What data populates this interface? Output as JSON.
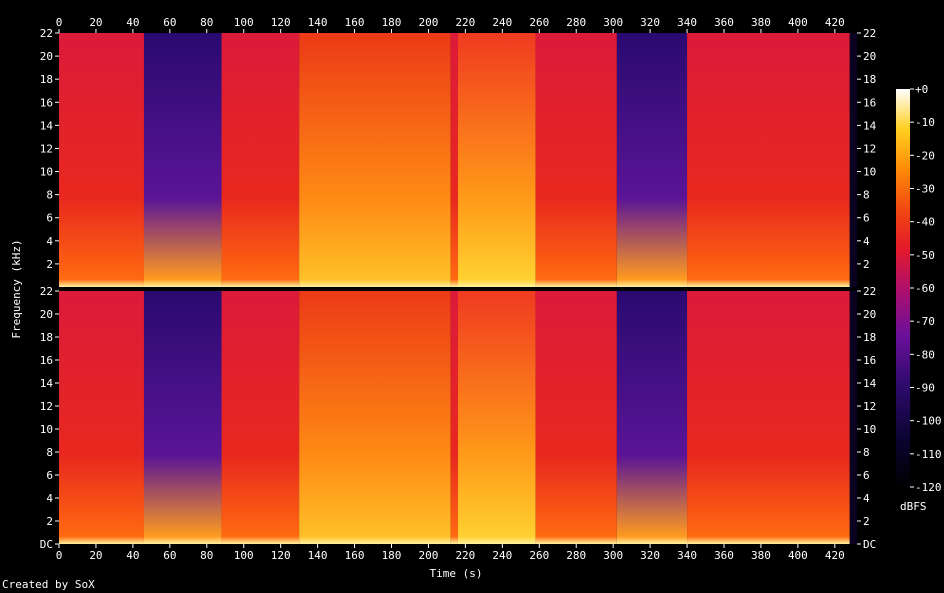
{
  "chart_data": {
    "type": "heatmap",
    "title": "",
    "xlabel": "Time (s)",
    "ylabel": "Frequency (kHz)",
    "colorbar_label": "dBFS",
    "x_ticks": [
      "0",
      "20",
      "40",
      "60",
      "80",
      "100",
      "120",
      "140",
      "160",
      "180",
      "200",
      "220",
      "240",
      "260",
      "280",
      "300",
      "320",
      "340",
      "360",
      "380",
      "400",
      "420"
    ],
    "x_range": [
      0,
      432
    ],
    "y_ticks": [
      "2",
      "4",
      "6",
      "8",
      "10",
      "12",
      "14",
      "16",
      "18",
      "20",
      "22"
    ],
    "y_ticks_lower_bottom": "DC",
    "y_range_khz": [
      0,
      22
    ],
    "colorbar_ticks": [
      "+0",
      "-10",
      "-20",
      "-30",
      "-40",
      "-50",
      "-60",
      "-70",
      "-80",
      "-90",
      "-100",
      "-110",
      "-120"
    ],
    "colorbar_range": [
      -120,
      0
    ],
    "channels": 2,
    "segments_seconds": [
      {
        "start": 0,
        "end": 46,
        "level": "loud"
      },
      {
        "start": 46,
        "end": 88,
        "level": "quiet"
      },
      {
        "start": 88,
        "end": 130,
        "level": "loud"
      },
      {
        "start": 130,
        "end": 212,
        "level": "very-loud"
      },
      {
        "start": 212,
        "end": 216,
        "level": "loud"
      },
      {
        "start": 216,
        "end": 258,
        "level": "dense"
      },
      {
        "start": 258,
        "end": 302,
        "level": "loud"
      },
      {
        "start": 302,
        "end": 340,
        "level": "quiet"
      },
      {
        "start": 340,
        "end": 428,
        "level": "loud"
      }
    ]
  },
  "credit": "Created by SoX"
}
